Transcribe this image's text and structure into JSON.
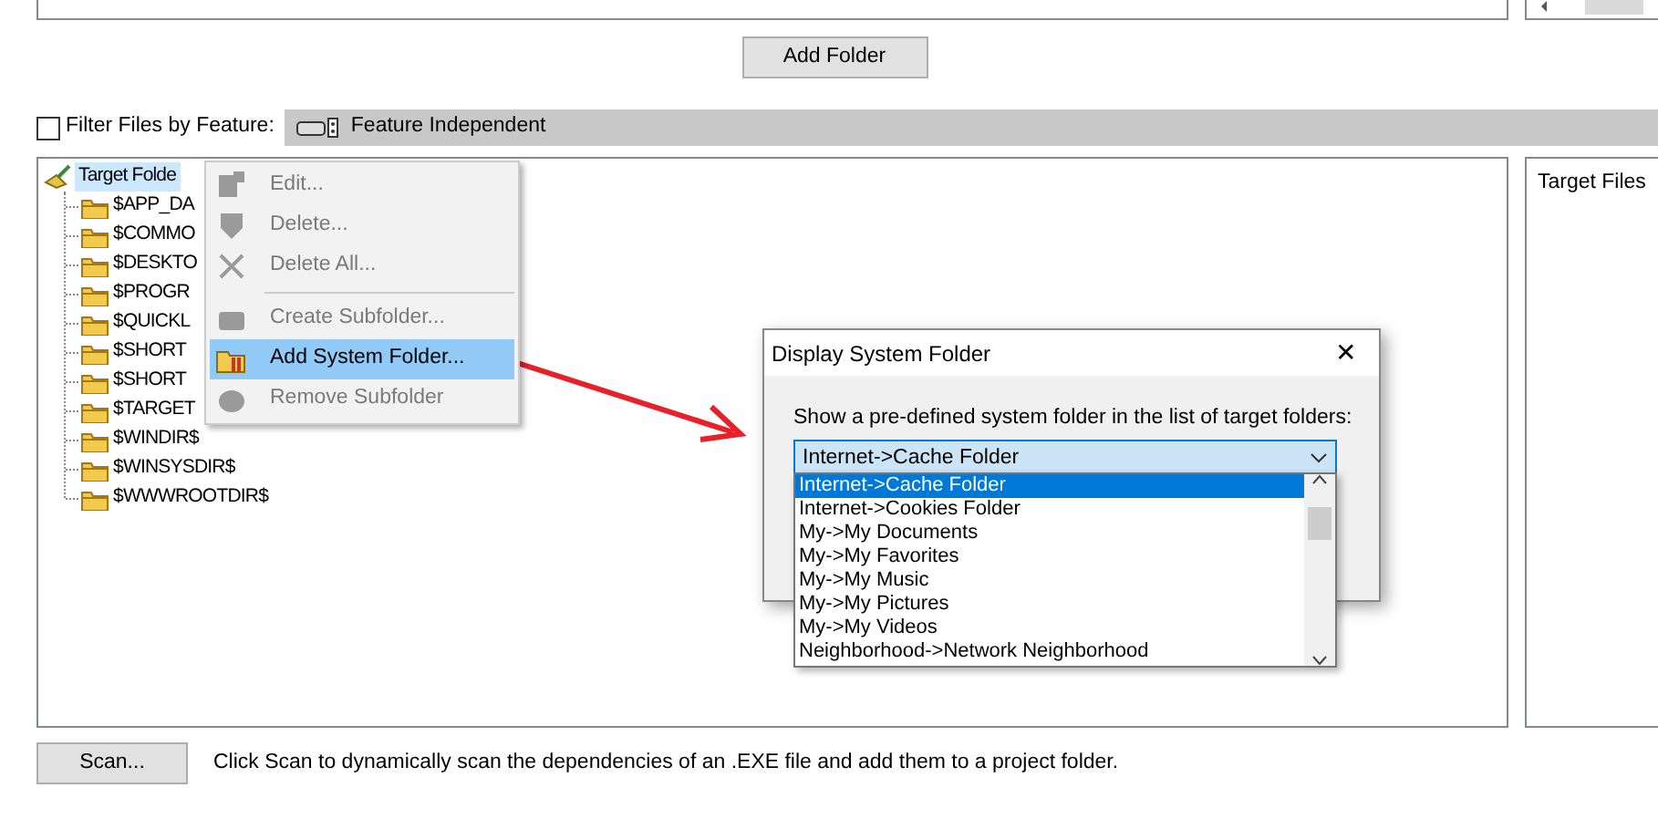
{
  "add_folder_button": "Add Folder",
  "filter": {
    "label": "Filter Files by Feature:",
    "checked": false,
    "feature": "Feature Independent"
  },
  "tree": {
    "label": "Target Folde",
    "selected": true,
    "children": [
      {
        "label": "$APP_DA"
      },
      {
        "label": "$COMMO"
      },
      {
        "label": "$DESKTO"
      },
      {
        "label": "$PROGR"
      },
      {
        "label": "$QUICKL"
      },
      {
        "label": "$SHORT"
      },
      {
        "label": "$SHORT"
      },
      {
        "label": "$TARGET"
      },
      {
        "label": "$WINDIR$"
      },
      {
        "label": "$WINSYSDIR$"
      },
      {
        "label": "$WWWROOTDIR$"
      }
    ]
  },
  "target_files_panel": {
    "title": "Target Files"
  },
  "context_menu": {
    "items": [
      {
        "kind": "item",
        "label": "Edit...",
        "disabled": true,
        "selected": false
      },
      {
        "kind": "item",
        "label": "Delete...",
        "disabled": true,
        "selected": false
      },
      {
        "kind": "item",
        "label": "Delete All...",
        "disabled": true,
        "selected": false
      },
      {
        "kind": "separator"
      },
      {
        "kind": "item",
        "label": "Create Subfolder...",
        "disabled": true,
        "selected": false
      },
      {
        "kind": "item",
        "label": "Add System Folder...",
        "disabled": false,
        "selected": true
      },
      {
        "kind": "item",
        "label": "Remove Subfolder",
        "disabled": true,
        "selected": false
      }
    ]
  },
  "dialog": {
    "title": "Display System Folder",
    "close": "✕",
    "prompt": "Show a pre-defined system folder in the list of target folders:",
    "combo_value": "Internet->Cache Folder",
    "options": [
      {
        "label": "Internet->Cache Folder",
        "selected": true
      },
      {
        "label": "Internet->Cookies Folder",
        "selected": false
      },
      {
        "label": "My->My Documents",
        "selected": false
      },
      {
        "label": "My->My Favorites",
        "selected": false
      },
      {
        "label": "My->My Music",
        "selected": false
      },
      {
        "label": "My->My Pictures",
        "selected": false
      },
      {
        "label": "My->My Videos",
        "selected": false
      },
      {
        "label": "Neighborhood->Network Neighborhood",
        "selected": false
      }
    ]
  },
  "scan_button": "Scan...",
  "scan_hint": "Click Scan to dynamically scan the dependencies of an .EXE file and add them to a project folder."
}
